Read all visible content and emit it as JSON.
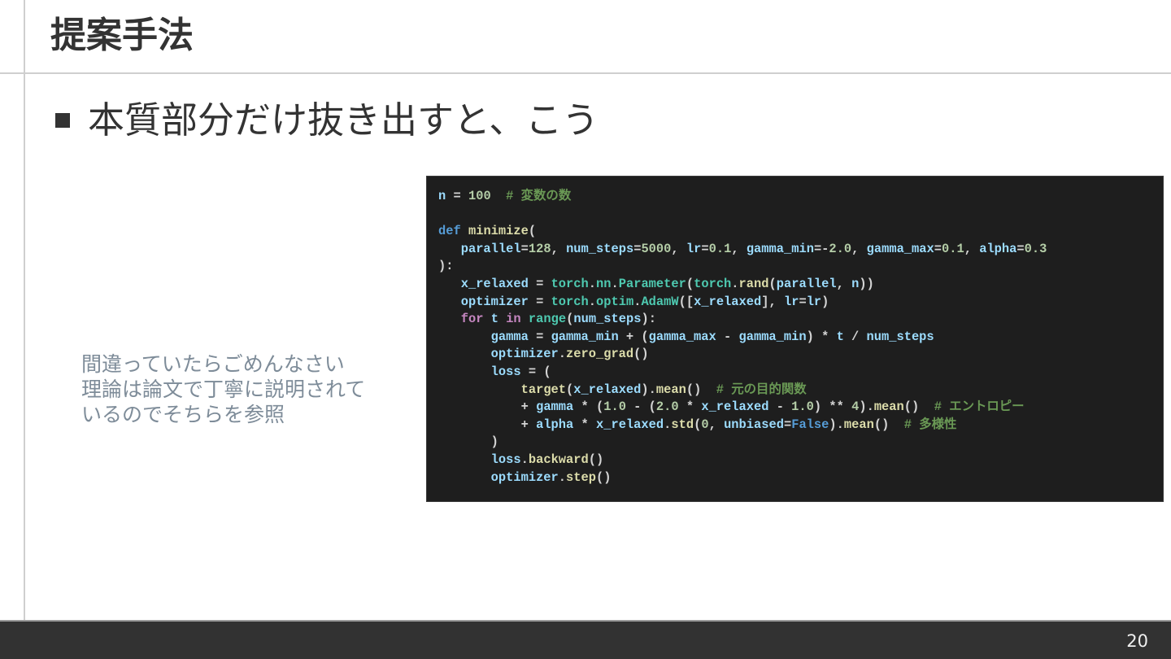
{
  "slide": {
    "title": "提案手法",
    "bullet": "本質部分だけ抜き出すと、こう",
    "note_lines": [
      "間違っていたらごめんなさい",
      "理論は論文で丁寧に説明されて",
      "いるのでそちらを参照"
    ],
    "page_number": "20"
  },
  "code": {
    "lines": [
      [
        [
          "v",
          "n"
        ],
        [
          "o",
          " = "
        ],
        [
          "n",
          "100"
        ],
        [
          "o",
          "  "
        ],
        [
          "c",
          "# 変数の数"
        ]
      ],
      [],
      [
        [
          "k",
          "def"
        ],
        [
          "o",
          " "
        ],
        [
          "f",
          "minimize"
        ],
        [
          "o",
          "("
        ]
      ],
      [
        [
          "o",
          "   "
        ],
        [
          "v",
          "parallel"
        ],
        [
          "o",
          "="
        ],
        [
          "n",
          "128"
        ],
        [
          "o",
          ", "
        ],
        [
          "v",
          "num_steps"
        ],
        [
          "o",
          "="
        ],
        [
          "n",
          "5000"
        ],
        [
          "o",
          ", "
        ],
        [
          "v",
          "lr"
        ],
        [
          "o",
          "="
        ],
        [
          "n",
          "0.1"
        ],
        [
          "o",
          ", "
        ],
        [
          "v",
          "gamma_min"
        ],
        [
          "o",
          "=-"
        ],
        [
          "n",
          "2.0"
        ],
        [
          "o",
          ", "
        ],
        [
          "v",
          "gamma_max"
        ],
        [
          "o",
          "="
        ],
        [
          "n",
          "0.1"
        ],
        [
          "o",
          ", "
        ],
        [
          "v",
          "alpha"
        ],
        [
          "o",
          "="
        ],
        [
          "n",
          "0.3"
        ]
      ],
      [
        [
          "o",
          "):"
        ]
      ],
      [
        [
          "o",
          "   "
        ],
        [
          "v",
          "x_relaxed"
        ],
        [
          "o",
          " = "
        ],
        [
          "t",
          "torch"
        ],
        [
          "o",
          "."
        ],
        [
          "t",
          "nn"
        ],
        [
          "o",
          "."
        ],
        [
          "t",
          "Parameter"
        ],
        [
          "o",
          "("
        ],
        [
          "t",
          "torch"
        ],
        [
          "o",
          "."
        ],
        [
          "f",
          "rand"
        ],
        [
          "o",
          "("
        ],
        [
          "v",
          "parallel"
        ],
        [
          "o",
          ", "
        ],
        [
          "v",
          "n"
        ],
        [
          "o",
          "))"
        ]
      ],
      [
        [
          "o",
          "   "
        ],
        [
          "v",
          "optimizer"
        ],
        [
          "o",
          " = "
        ],
        [
          "t",
          "torch"
        ],
        [
          "o",
          "."
        ],
        [
          "t",
          "optim"
        ],
        [
          "o",
          "."
        ],
        [
          "t",
          "AdamW"
        ],
        [
          "o",
          "(["
        ],
        [
          "v",
          "x_relaxed"
        ],
        [
          "o",
          "], "
        ],
        [
          "v",
          "lr"
        ],
        [
          "o",
          "="
        ],
        [
          "v",
          "lr"
        ],
        [
          "o",
          ")"
        ]
      ],
      [
        [
          "o",
          "   "
        ],
        [
          "p",
          "for"
        ],
        [
          "o",
          " "
        ],
        [
          "v",
          "t"
        ],
        [
          "o",
          " "
        ],
        [
          "p",
          "in"
        ],
        [
          "o",
          " "
        ],
        [
          "t",
          "range"
        ],
        [
          "o",
          "("
        ],
        [
          "v",
          "num_steps"
        ],
        [
          "o",
          "):"
        ]
      ],
      [
        [
          "o",
          "       "
        ],
        [
          "v",
          "gamma"
        ],
        [
          "o",
          " = "
        ],
        [
          "v",
          "gamma_min"
        ],
        [
          "o",
          " + ("
        ],
        [
          "v",
          "gamma_max"
        ],
        [
          "o",
          " - "
        ],
        [
          "v",
          "gamma_min"
        ],
        [
          "o",
          ") * "
        ],
        [
          "v",
          "t"
        ],
        [
          "o",
          " / "
        ],
        [
          "v",
          "num_steps"
        ]
      ],
      [
        [
          "o",
          "       "
        ],
        [
          "v",
          "optimizer"
        ],
        [
          "o",
          "."
        ],
        [
          "f",
          "zero_grad"
        ],
        [
          "o",
          "()"
        ]
      ],
      [
        [
          "o",
          "       "
        ],
        [
          "v",
          "loss"
        ],
        [
          "o",
          " = ("
        ]
      ],
      [
        [
          "o",
          "           "
        ],
        [
          "f",
          "target"
        ],
        [
          "o",
          "("
        ],
        [
          "v",
          "x_relaxed"
        ],
        [
          "o",
          ")."
        ],
        [
          "f",
          "mean"
        ],
        [
          "o",
          "()  "
        ],
        [
          "c",
          "# 元の目的関数"
        ]
      ],
      [
        [
          "o",
          "           + "
        ],
        [
          "v",
          "gamma"
        ],
        [
          "o",
          " * ("
        ],
        [
          "n",
          "1.0"
        ],
        [
          "o",
          " - ("
        ],
        [
          "n",
          "2.0"
        ],
        [
          "o",
          " * "
        ],
        [
          "v",
          "x_relaxed"
        ],
        [
          "o",
          " - "
        ],
        [
          "n",
          "1.0"
        ],
        [
          "o",
          ") ** "
        ],
        [
          "n",
          "4"
        ],
        [
          "o",
          ")."
        ],
        [
          "f",
          "mean"
        ],
        [
          "o",
          "()  "
        ],
        [
          "c",
          "# エントロピー"
        ]
      ],
      [
        [
          "o",
          "           + "
        ],
        [
          "v",
          "alpha"
        ],
        [
          "o",
          " * "
        ],
        [
          "v",
          "x_relaxed"
        ],
        [
          "o",
          "."
        ],
        [
          "f",
          "std"
        ],
        [
          "o",
          "("
        ],
        [
          "n",
          "0"
        ],
        [
          "o",
          ", "
        ],
        [
          "v",
          "unbiased"
        ],
        [
          "o",
          "="
        ],
        [
          "k",
          "False"
        ],
        [
          "o",
          ")."
        ],
        [
          "f",
          "mean"
        ],
        [
          "o",
          "()  "
        ],
        [
          "c",
          "# 多様性"
        ]
      ],
      [
        [
          "o",
          "       )"
        ]
      ],
      [
        [
          "o",
          "       "
        ],
        [
          "v",
          "loss"
        ],
        [
          "o",
          "."
        ],
        [
          "f",
          "backward"
        ],
        [
          "o",
          "()"
        ]
      ],
      [
        [
          "o",
          "       "
        ],
        [
          "v",
          "optimizer"
        ],
        [
          "o",
          "."
        ],
        [
          "f",
          "step"
        ],
        [
          "o",
          "()"
        ]
      ]
    ]
  }
}
